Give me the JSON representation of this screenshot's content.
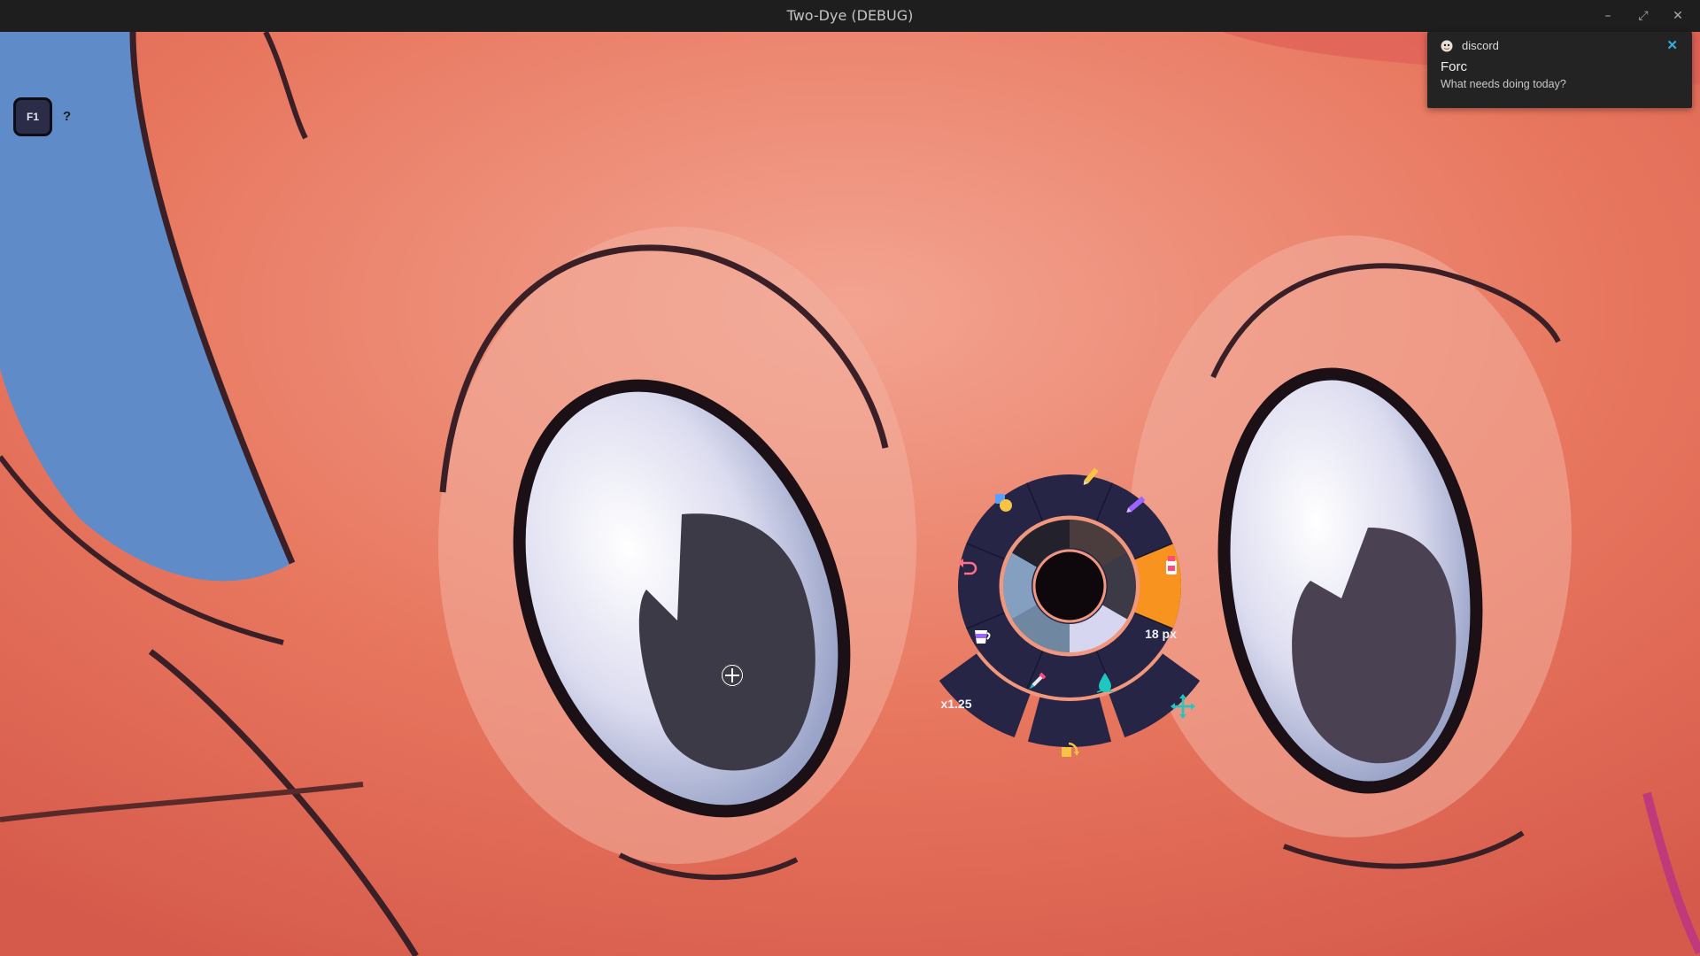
{
  "window": {
    "title": "Two-Dye (DEBUG)",
    "minimize_glyph": "–",
    "maximize_glyph": "⤢",
    "close_glyph": "✕"
  },
  "help": {
    "key_label": "F1",
    "help_glyph": "?"
  },
  "notification": {
    "app": "discord",
    "app_icon": "discord-avatar-icon",
    "sender": "Forc",
    "message": "What needs doing today?",
    "close_glyph": "✕"
  },
  "wheel": {
    "brush_size": "18 px",
    "zoom": "x1.25",
    "tools": [
      "pencil-icon",
      "marker-icon",
      "paint-tube-icon",
      "water-drop-icon",
      "eyedropper-icon",
      "cup-icon",
      "undo-icon",
      "shapes-icon",
      "fill-bucket-icon",
      "move-icon"
    ],
    "active_tool": "paint-tube-icon",
    "active_color": "#0e070b",
    "swatches": [
      "#4b3c3e",
      "#3c3a46",
      "#d6d6f0",
      "#6f87a1",
      "#849fbf",
      "#22212c"
    ],
    "accent": "#f7931e",
    "panel_color": "#262545"
  }
}
